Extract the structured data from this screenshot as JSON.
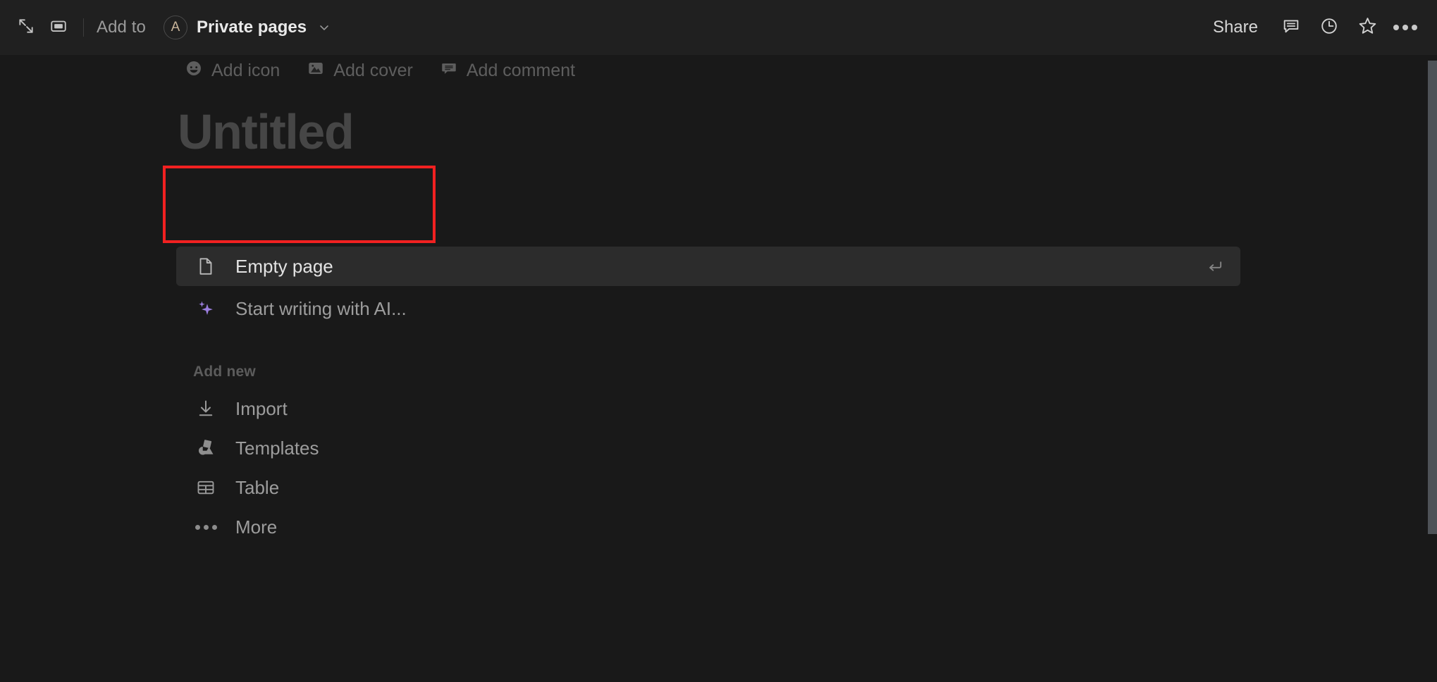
{
  "topbar": {
    "expand_icon": "expand-arrows-icon",
    "panel_icon": "panel-rectangle-icon",
    "add_to_label": "Add to",
    "avatar_initial": "A",
    "breadcrumb_title": "Private pages",
    "chevron_icon": "chevron-down-icon",
    "share_label": "Share",
    "comment_icon": "comment-bubble-icon",
    "history_icon": "clock-history-icon",
    "favorite_icon": "star-icon",
    "more_icon": "ellipsis-icon"
  },
  "page_options": [
    {
      "icon": "smiley-icon",
      "label": "Add icon"
    },
    {
      "icon": "image-icon",
      "label": "Add cover"
    },
    {
      "icon": "comment-bubble-icon",
      "label": "Add comment"
    }
  ],
  "title": {
    "placeholder": "Untitled",
    "highlight_color": "#f12121"
  },
  "menu": {
    "primary": [
      {
        "icon": "document-page-icon",
        "label": "Empty page",
        "selected": true,
        "shortcut_icon": "enter-return-icon"
      },
      {
        "icon": "ai-sparkle-icon",
        "label": "Start writing with AI...",
        "selected": false
      }
    ],
    "section_label": "Add new",
    "items": [
      {
        "icon": "download-import-icon",
        "label": "Import"
      },
      {
        "icon": "shapes-templates-icon",
        "label": "Templates"
      },
      {
        "icon": "table-grid-icon",
        "label": "Table"
      },
      {
        "icon": "ellipsis-icon",
        "label": "More"
      }
    ]
  },
  "colors": {
    "background": "#191919",
    "topbar": "#202020",
    "selected_row": "#2c2c2c",
    "accent_ai": "#9b7ede",
    "scrollbar": "#4e5257"
  }
}
